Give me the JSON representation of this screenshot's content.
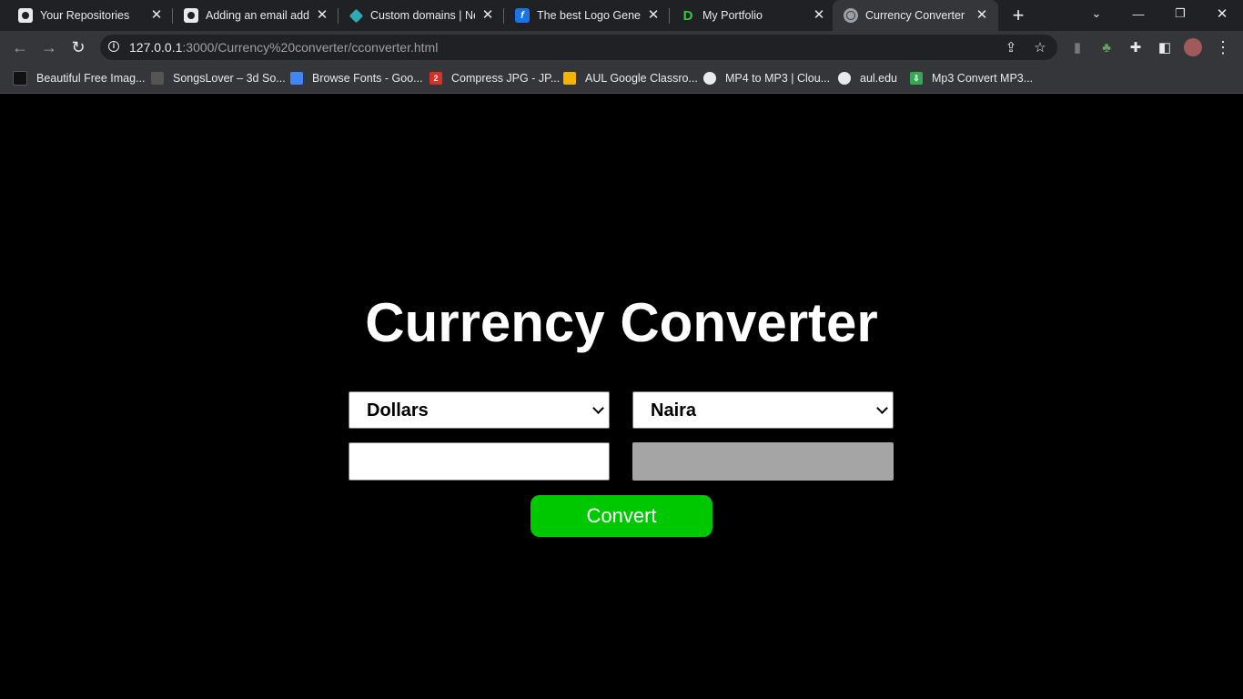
{
  "browser": {
    "tabs": [
      {
        "title": "Your Repositories",
        "icon": "github-icon"
      },
      {
        "title": "Adding an email address",
        "icon": "github-icon"
      },
      {
        "title": "Custom domains | Netlify",
        "icon": "netlify-icon"
      },
      {
        "title": "The best Logo Generator",
        "icon": "logo-generator-icon"
      },
      {
        "title": "My Portfolio",
        "icon": "portfolio-d-icon"
      },
      {
        "title": "Currency Converter",
        "icon": "globe-icon",
        "active": true
      }
    ],
    "url_host": "127.0.0.1",
    "url_rest": ":3000/Currency%20converter/cconverter.html",
    "bookmarks": [
      "Beautiful Free Imag...",
      "SongsLover – 3d So...",
      "Browse Fonts - Goo...",
      "Compress JPG - JP...",
      "AUL Google Classro...",
      "MP4 to MP3 | Clou...",
      "aul.edu",
      "Mp3 Convert MP3..."
    ],
    "bookmark_badge": "2"
  },
  "page": {
    "heading": "Currency Converter",
    "from_currency": "Dollars",
    "to_currency": "Naira",
    "amount_value": "",
    "result_value": "",
    "convert_label": "Convert",
    "colors": {
      "background": "#000000",
      "button": "#00c800",
      "result_bg": "#a5a5a5"
    }
  }
}
